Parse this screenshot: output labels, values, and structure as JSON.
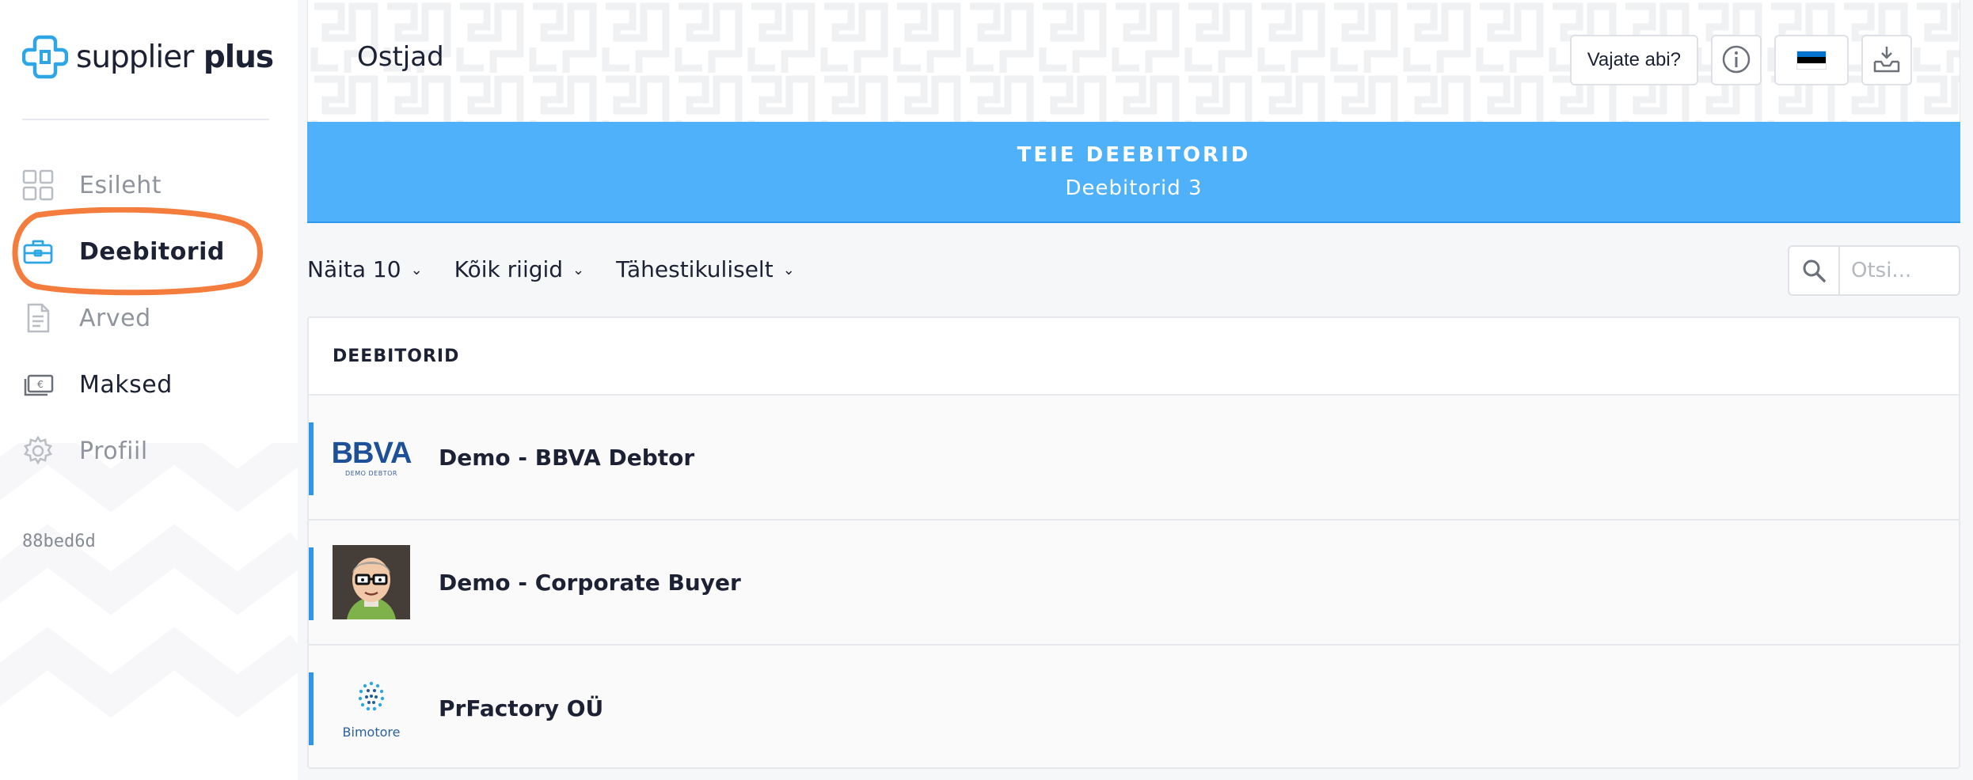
{
  "brand": {
    "name_light": "supplier",
    "name_bold": " plus"
  },
  "sidebar": {
    "items": [
      {
        "label": "Esileht"
      },
      {
        "label": "Deebitorid"
      },
      {
        "label": "Arved"
      },
      {
        "label": "Maksed"
      },
      {
        "label": "Profiil"
      }
    ],
    "version": "88bed6d"
  },
  "header": {
    "title": "Ostjad",
    "help_label": "Vajate abi?",
    "icons": [
      "info-icon",
      "estonia-flag-icon",
      "download-icon"
    ]
  },
  "banner": {
    "title": "TEIE DEEBITORID",
    "subtitle": "Deebitorid 3"
  },
  "filters": {
    "show": "Näita 10",
    "countries": "Kõik riigid",
    "sort": "Tähestikuliselt"
  },
  "search": {
    "placeholder": "Otsi..."
  },
  "list": {
    "header": "DEEBITORID",
    "rows": [
      {
        "name": "Demo - BBVA Debtor",
        "logo_text": "BBVA",
        "logo_sub": "DEMO DEBTOR"
      },
      {
        "name": "Demo - Corporate Buyer"
      },
      {
        "name": "PrFactory OÜ",
        "logo_text": "Bimotore"
      }
    ]
  },
  "colors": {
    "accent": "#4fb1f9",
    "row_accent": "#2f95e8",
    "highlight": "#f47c3c",
    "logo_blue": "#2ea6e6"
  }
}
